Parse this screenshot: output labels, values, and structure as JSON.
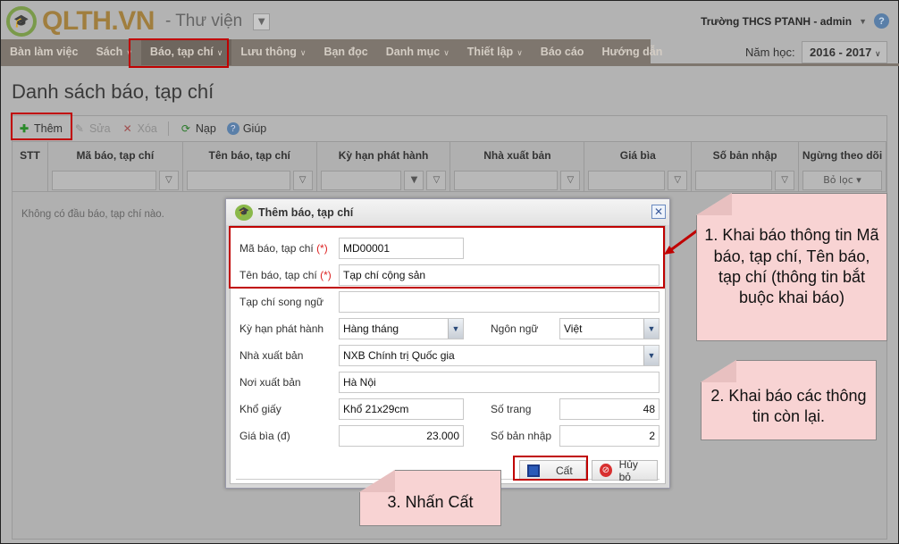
{
  "header": {
    "logo_text": "QLTH.VN",
    "app_name": "- Thư viện",
    "user": "Trường THCS PTANH - admin",
    "year_label": "Năm học:",
    "year_value": "2016 - 2017"
  },
  "nav": [
    {
      "label": "Bàn làm việc",
      "chev": false
    },
    {
      "label": "Sách",
      "chev": true
    },
    {
      "label": "Báo, tạp chí",
      "chev": true,
      "active": true
    },
    {
      "label": "Lưu thông",
      "chev": true
    },
    {
      "label": "Bạn đọc",
      "chev": false
    },
    {
      "label": "Danh mục",
      "chev": true
    },
    {
      "label": "Thiết lập",
      "chev": true
    },
    {
      "label": "Báo cáo",
      "chev": false
    },
    {
      "label": "Hướng dẫn",
      "chev": false
    }
  ],
  "page_title": "Danh sách báo, tạp chí",
  "toolbar": {
    "add": "Thêm",
    "edit": "Sửa",
    "delete": "Xóa",
    "reload": "Nạp",
    "help": "Giúp"
  },
  "columns": [
    "STT",
    "Mã báo, tạp chí",
    "Tên báo, tạp chí",
    "Kỳ hạn phát hành",
    "Nhà xuất bản",
    "Giá bìa",
    "Số bản nhập",
    "Ngừng theo dõi"
  ],
  "filter_dropdown": "Bỏ lọc",
  "empty_text": "Không có đầu báo, tạp chí nào.",
  "dialog": {
    "title": "Thêm báo, tạp chí",
    "required_mark": "(*)",
    "labels": {
      "code": "Mã báo, tạp chí",
      "name": "Tên báo, tạp chí",
      "bilingual": "Tạp chí song ngữ",
      "period": "Kỳ hạn phát hành",
      "language": "Ngôn ngữ",
      "publisher": "Nhà xuất bản",
      "place": "Nơi xuất bản",
      "size": "Khổ giấy",
      "pages": "Số trang",
      "price": "Giá bìa (đ)",
      "copies": "Số bản nhập"
    },
    "values": {
      "code": "MD00001",
      "name": "Tạp chí cộng sản",
      "bilingual": "",
      "period": "Hàng tháng",
      "language": "Việt",
      "publisher": "NXB Chính trị Quốc gia",
      "place": "Hà Nội",
      "size": "Khổ 21x29cm",
      "pages": "48",
      "price": "23.000",
      "copies": "2"
    },
    "save": "Cất",
    "cancel": "Hủy bỏ"
  },
  "callouts": [
    "1. Khai báo thông tin Mã báo, tạp chí, Tên báo, tạp chí (thông tin bắt buộc khai báo)",
    "2. Khai báo các thông tin còn lại.",
    "3. Nhấn Cất"
  ]
}
